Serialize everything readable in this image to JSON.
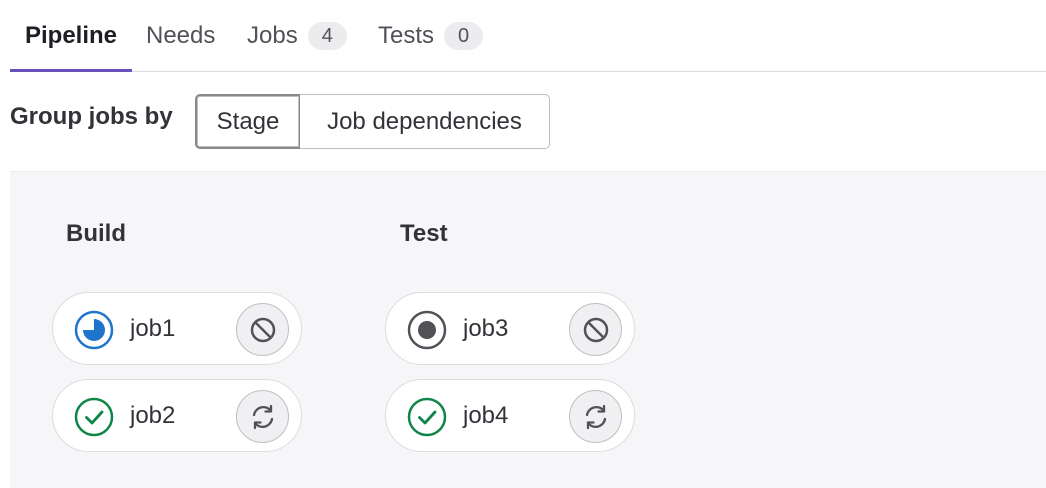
{
  "tabs": [
    {
      "label": "Pipeline",
      "active": true
    },
    {
      "label": "Needs",
      "active": false
    },
    {
      "label": "Jobs",
      "count": "4",
      "active": false
    },
    {
      "label": "Tests",
      "count": "0",
      "active": false
    }
  ],
  "group_by": {
    "label": "Group jobs by",
    "options": [
      {
        "label": "Stage",
        "selected": true
      },
      {
        "label": "Job dependencies",
        "selected": false
      }
    ]
  },
  "stages": [
    {
      "title": "Build",
      "jobs": [
        {
          "name": "job1",
          "status": "running",
          "status_icon": "status-running-icon",
          "action_icon": "cancel-icon"
        },
        {
          "name": "job2",
          "status": "success",
          "status_icon": "status-success-icon",
          "action_icon": "retry-icon"
        }
      ]
    },
    {
      "title": "Test",
      "jobs": [
        {
          "name": "job3",
          "status": "pending",
          "status_icon": "status-pending-icon",
          "action_icon": "cancel-icon"
        },
        {
          "name": "job4",
          "status": "success",
          "status_icon": "status-success-icon",
          "action_icon": "retry-icon"
        }
      ]
    }
  ],
  "colors": {
    "accent": "#6b4fbb",
    "running": "#1f75cb",
    "success": "#108548",
    "pending": "#535158",
    "action": "#535158"
  }
}
